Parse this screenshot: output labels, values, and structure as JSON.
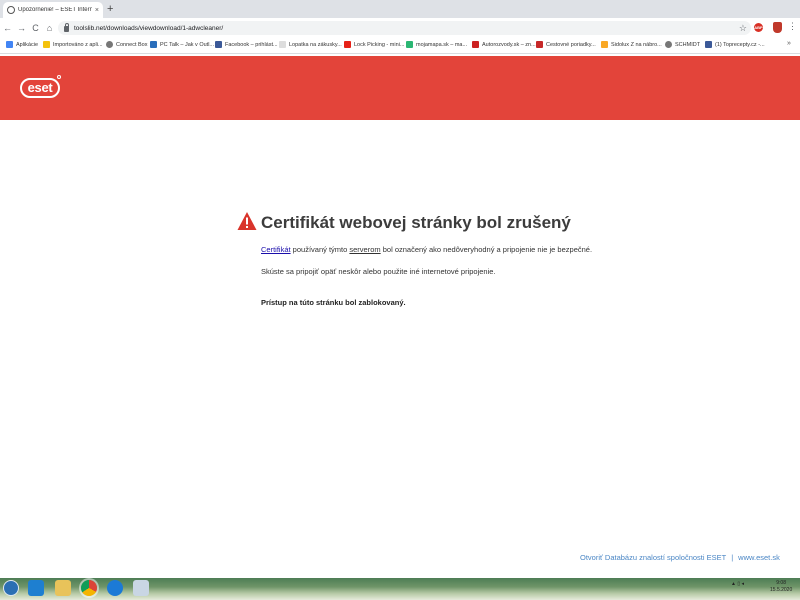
{
  "browser": {
    "tab_title": "Upozornenie! – ESET Internet Se",
    "tab_close": "×",
    "new_tab": "+",
    "url": "toolslib.net/downloads/viewdownload/1-adwcleaner/",
    "nav_back": "←",
    "nav_forward": "→",
    "nav_reload": "C",
    "nav_home": "⌂",
    "star": "☆",
    "ext_badge": "ABP",
    "menu": "⋮"
  },
  "bookmarks": [
    {
      "label": "Aplikácie",
      "color": "#4285f4"
    },
    {
      "label": "Importováno z apli...",
      "color": "#f4c20d"
    },
    {
      "label": "Connect Box",
      "color": "#777777"
    },
    {
      "label": "PC Talk – Jak v Outl...",
      "color": "#2a6ebb"
    },
    {
      "label": "Facebook – prihlást...",
      "color": "#3b5998"
    },
    {
      "label": "Lopatka na zákusky...",
      "color": "#dddddd"
    },
    {
      "label": "Lock Picking - mini...",
      "color": "#e62117"
    },
    {
      "label": "mojamapa.sk – ma...",
      "color": "#2bb673"
    },
    {
      "label": "Autorozvody.sk – zn...",
      "color": "#cc2222"
    },
    {
      "label": "Cestovné poriadky...",
      "color": "#c62828"
    },
    {
      "label": "Sidolux Z na nábro...",
      "color": "#f9a825"
    },
    {
      "label": "SCHMIDT",
      "color": "#777777"
    },
    {
      "label": "(1) Toprecepty.cz -...",
      "color": "#3b5998"
    }
  ],
  "bookmarks_more": "»",
  "eset": {
    "logo": "eset",
    "heading": "Certifikát webovej stránky bol zrušený",
    "p1_link_cert": "Certifikát",
    "p1_mid": " používaný týmto ",
    "p1_link_server": "serverom",
    "p1_end": " bol označený ako nedôveryhodný a pripojenie nie je bezpečné.",
    "p2": "Skúste sa pripojiť opäť neskôr alebo použite iné internetové pripojenie.",
    "p3": "Prístup na túto stránku bol zablokovaný.",
    "footer_kb": "Otvoriť Databázu znalostí spoločnosti ESET",
    "footer_sep": "|",
    "footer_site": "www.eset.sk"
  },
  "taskbar": {
    "tray": "▲  ▯  ◂",
    "time": "9:08",
    "date": "15.5.2020"
  },
  "colors": {
    "eset_red": "#e3443a",
    "warning_red": "#d9342b",
    "link_blue": "#1a0dab",
    "footer_blue": "#4a86c5"
  }
}
